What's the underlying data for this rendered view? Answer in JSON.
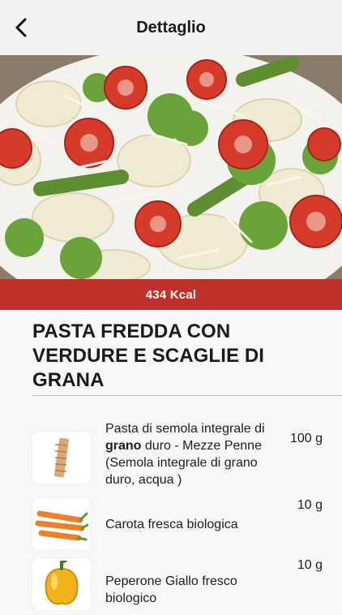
{
  "navbar": {
    "title": "Dettaglio"
  },
  "hero": {
    "kcal": "434 Kcal"
  },
  "recipe": {
    "title": "PASTA FREDDA CON VERDURE E SCAGLIE DI GRANA"
  },
  "ingredients": [
    {
      "name_before": "Pasta di semola integrale di ",
      "name_bold": "grano",
      "name_after": " duro - Mezze Penne (Semola integrale di grano duro, acqua )",
      "qty": "100 g",
      "icon": "penne-pasta-icon"
    },
    {
      "name": "Carota fresca biologica",
      "qty": "10 g",
      "icon": "carrot-icon"
    },
    {
      "name": "Peperone Giallo fresco biologico",
      "qty": "10 g",
      "icon": "yellow-pepper-icon"
    }
  ],
  "colors": {
    "accent": "#c1312b",
    "navbar": "#f2f2f2",
    "background": "#f7f7f7"
  }
}
